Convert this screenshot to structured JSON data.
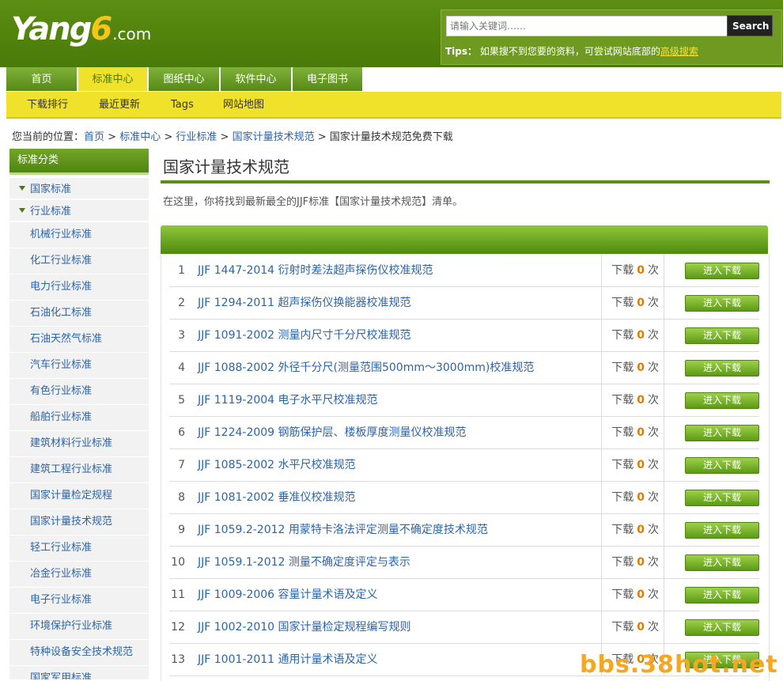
{
  "header": {
    "logo_text": "Yang",
    "logo_six": "6",
    "logo_domain": ".com",
    "search_placeholder": "请输入关键词……",
    "search_button": "Search",
    "tips_label": "Tips：",
    "tips_text": "如果搜不到您要的资料，可尝试网站底部的",
    "tips_link": "高级搜索"
  },
  "main_nav": [
    {
      "label": "首页",
      "active": false
    },
    {
      "label": "标准中心",
      "active": true
    },
    {
      "label": "图纸中心",
      "active": false
    },
    {
      "label": "软件中心",
      "active": false
    },
    {
      "label": "电子图书",
      "active": false
    }
  ],
  "sub_nav": [
    "下载排行",
    "最近更新",
    "Tags",
    "网站地图"
  ],
  "breadcrumb": {
    "prefix": "您当前的位置：",
    "items": [
      "首页",
      "标准中心",
      "行业标准",
      "国家计量技术规范"
    ],
    "separator": " > ",
    "current": "国家计量技术规范免费下载"
  },
  "sidebar": {
    "title": "标准分类",
    "categories": [
      "国家标准",
      "行业标准"
    ],
    "items": [
      "机械行业标准",
      "化工行业标准",
      "电力行业标准",
      "石油化工标准",
      "石油天然气标准",
      "汽车行业标准",
      "有色行业标准",
      "船舶行业标准",
      "建筑材料行业标准",
      "建筑工程行业标准",
      "国家计量检定规程",
      "国家计量技术规范",
      "轻工行业标准",
      "冶金行业标准",
      "电子行业标准",
      "环境保护行业标准",
      "特种设备安全技术规范",
      "国家军用标准"
    ]
  },
  "main": {
    "title": "国家计量技术规范",
    "intro": "在这里，你将找到最新最全的JJF标准【国家计量技术规范】清单。",
    "download_prefix": "下载",
    "download_suffix": "次",
    "button_label": "进入下载",
    "rows": [
      {
        "num": "1",
        "title": "JJF 1447-2014 衍射时差法超声探伤仪校准规范",
        "count": "0"
      },
      {
        "num": "2",
        "title": "JJF 1294-2011 超声探伤仪换能器校准规范",
        "count": "0"
      },
      {
        "num": "3",
        "title": "JJF 1091-2002 测量内尺寸千分尺校准规范",
        "count": "0"
      },
      {
        "num": "4",
        "title": "JJF 1088-2002 外径千分尺(测量范围500mm～3000mm)校准规范",
        "count": "0"
      },
      {
        "num": "5",
        "title": "JJF 1119-2004 电子水平尺校准规范",
        "count": "0"
      },
      {
        "num": "6",
        "title": "JJF 1224-2009 钢筋保护层、楼板厚度测量仪校准规范",
        "count": "0"
      },
      {
        "num": "7",
        "title": "JJF 1085-2002 水平尺校准规范",
        "count": "0"
      },
      {
        "num": "8",
        "title": "JJF 1081-2002 垂准仪校准规范",
        "count": "0"
      },
      {
        "num": "9",
        "title": "JJF 1059.2-2012 用蒙特卡洛法评定测量不确定度技术规范",
        "count": "0"
      },
      {
        "num": "10",
        "title": "JJF 1059.1-2012 测量不确定度评定与表示",
        "count": "0"
      },
      {
        "num": "11",
        "title": "JJF 1009-2006 容量计量术语及定义",
        "count": "0"
      },
      {
        "num": "12",
        "title": "JJF 1002-2010 国家计量检定规程编写规则",
        "count": "0"
      },
      {
        "num": "13",
        "title": "JJF 1001-2011 通用计量术语及定义",
        "count": "0"
      }
    ]
  },
  "watermark": "bbs.38hot.net"
}
